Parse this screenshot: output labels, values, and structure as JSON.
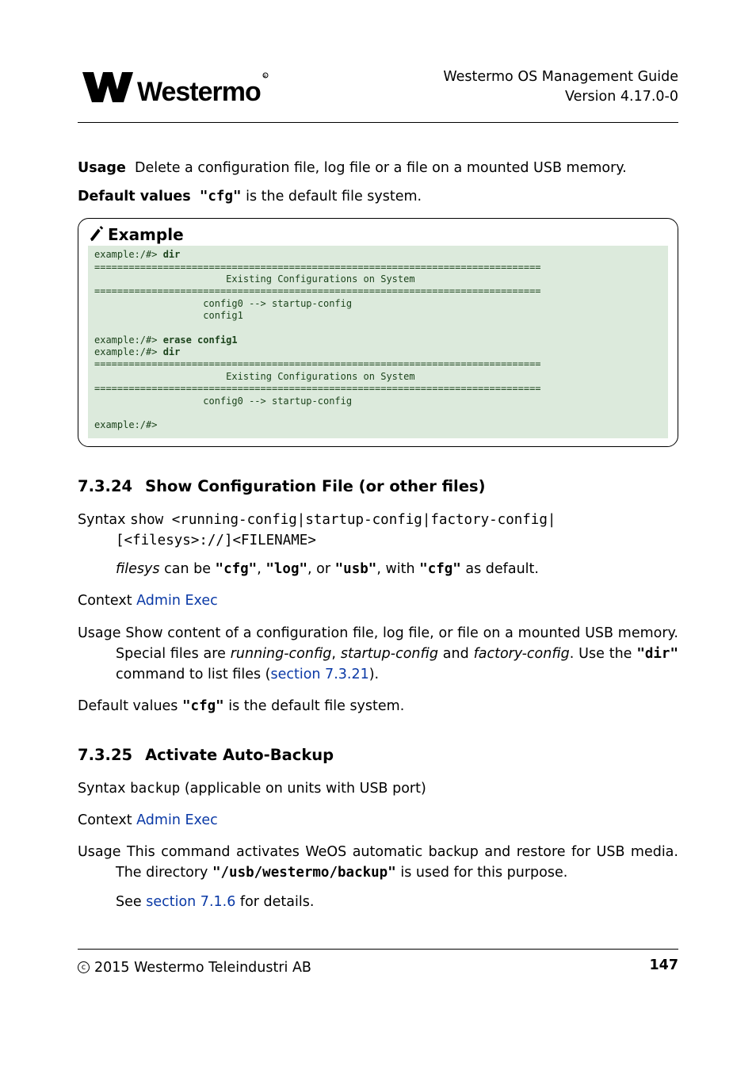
{
  "header": {
    "doc_title": "Westermo OS Management Guide",
    "version": "Version 4.17.0-0",
    "logo_alt": "Westermo"
  },
  "usage_top": {
    "label": "Usage",
    "text": "Delete a configuration file, log file or a file on a mounted USB memory."
  },
  "defaults_top": {
    "label": "Default values",
    "code": "\"cfg\"",
    "tail": " is the default file system."
  },
  "example": {
    "title": "Example",
    "prompt1": "example:/#> ",
    "cmd1": "dir",
    "hr": "==============================================================================",
    "title_line": "                       Existing Configurations on System",
    "line_cfg0": "                   config0 --> startup-config",
    "line_cfg1": "                   config1",
    "prompt2": "example:/#> ",
    "cmd2": "erase config1",
    "prompt3": "example:/#> ",
    "cmd3": "dir",
    "line_cfg0b": "                   config0 --> startup-config",
    "prompt4": "example:/#>"
  },
  "heading_24": {
    "num": "7.3.24",
    "title": "Show Configuration File (or other files)"
  },
  "syntax_24": {
    "label": "Syntax",
    "code_l1": "show <running-config|startup-config|factory-config|",
    "code_l2": "[<filesys>://]<FILENAME>",
    "filesys_lead": "filesys",
    "filesys_body": " can be ",
    "cfg": "\"cfg\"",
    "log": "\"log\"",
    "usb": "\"usb\"",
    "with_txt": ", with ",
    "default_cfg": "\"cfg\"",
    "as_default": " as default."
  },
  "context_24": {
    "label": "Context",
    "link": "Admin Exec"
  },
  "usage_24": {
    "label": "Usage",
    "line1": "Show content of a configuration file, log file, or file on a mounted USB memory.  Special files are ",
    "rc": "running-config",
    "sc": "startup-config",
    "fc": "factory-config",
    "tail1": ". Use the ",
    "dir": "\"dir\"",
    "tail2": " command to list files (",
    "link": "section 7.3.21",
    "tail3": ")."
  },
  "defaults_24": {
    "label": "Default values",
    "code": "\"cfg\"",
    "tail": " is the default file system."
  },
  "heading_25": {
    "num": "7.3.25",
    "title": "Activate Auto-Backup"
  },
  "syntax_25": {
    "label": "Syntax",
    "code": "backup",
    "tail": " (applicable on units with USB port)"
  },
  "context_25": {
    "label": "Context",
    "link": "Admin Exec"
  },
  "usage_25": {
    "label": "Usage",
    "line1": "This command activates WeOS automatic backup and restore for USB media. The directory ",
    "path": "\"/usb/westermo/backup\"",
    "tail1": " is used for this purpose.",
    "line2a": "See ",
    "link": "section 7.1.6",
    "line2b": " for details."
  },
  "footer": {
    "copyright": "2015 Westermo Teleindustri AB",
    "page": "147"
  }
}
